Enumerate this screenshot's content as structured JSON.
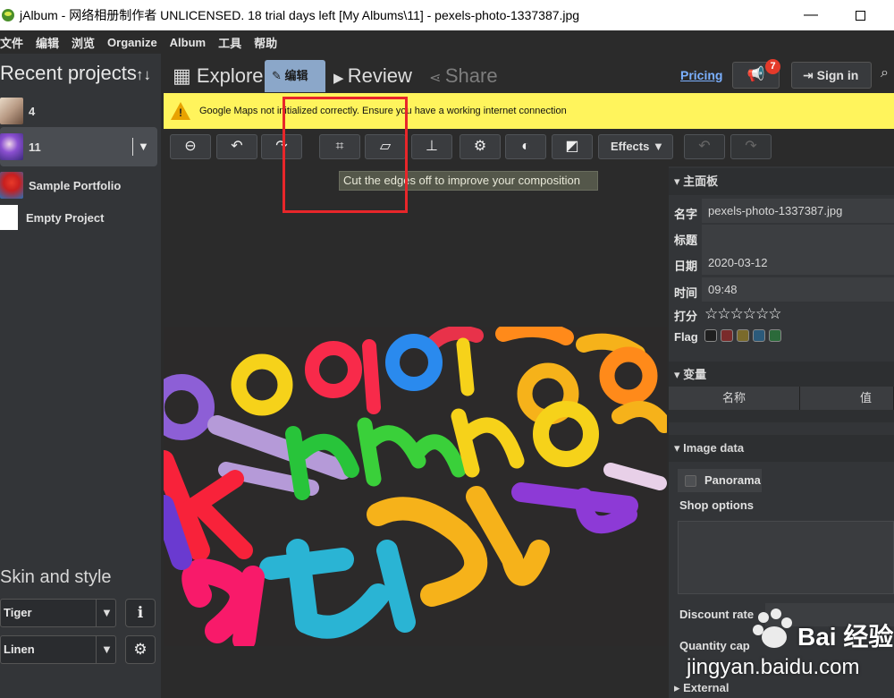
{
  "titlebar": {
    "title": "jAlbum - 网络相册制作者 UNLICENSED. 18 trial days left [My Albums\\11] - pexels-photo-1337387.jpg",
    "minimize": "—"
  },
  "menu": [
    "文件",
    "编辑",
    "浏览",
    "Organize",
    "Album",
    "工具",
    "帮助"
  ],
  "recent": {
    "title": "Recent projects",
    "sort_icon": "↑↓",
    "projects": [
      {
        "label": "4"
      },
      {
        "label": "11"
      },
      {
        "label": "Sample Portfolio"
      },
      {
        "label": "Empty Project"
      }
    ]
  },
  "skin": {
    "title": "Skin and style",
    "skin_value": "Tiger",
    "style_value": "Linen",
    "caret": "▼",
    "info_icon": "ℹ",
    "gear_icon": "⚙"
  },
  "tabs": {
    "explore": "Explore",
    "edit": "编辑",
    "review": "Review",
    "share": "Share"
  },
  "header": {
    "pricing": "Pricing",
    "badge": "7",
    "signin": "Sign in"
  },
  "warning": {
    "text": "Google Maps not initialized correctly. Ensure you have a working internet connection"
  },
  "toolbar": {
    "effects": "Effects ▼"
  },
  "tooltip": "Cut the edges off to improve your composition",
  "props": {
    "section": "主面板",
    "name_label": "名字",
    "name_value": "pexels-photo-1337387.jpg",
    "title_label": "标题",
    "title_value": "",
    "date_label": "日期",
    "date_value": "2020-03-12",
    "time_label": "时间",
    "time_value": "09:48",
    "rating_label": "打分",
    "rating": 0,
    "rating_max": 6,
    "flag_label": "Flag",
    "flag_colors": [
      "#1f1f1f",
      "#7a2b2b",
      "#7a6a2b",
      "#2b5a7a",
      "#2b6a3a"
    ]
  },
  "variables": {
    "section": "变量",
    "col_name": "名称",
    "col_value": "值"
  },
  "image_data": {
    "section": "Image data",
    "panorama": "Panorama",
    "shop": "Shop options",
    "discount": "Discount rate",
    "quantity": "Quantity cap",
    "external": "External"
  },
  "watermark": {
    "text1": "Bai 经验",
    "text2": "jingyan.baidu.com"
  },
  "colors": {
    "accent_tab": "#8ba7c9",
    "warning_bg": "#fff45c",
    "highlight_box": "#e8262a",
    "badge": "#e43a2a"
  }
}
